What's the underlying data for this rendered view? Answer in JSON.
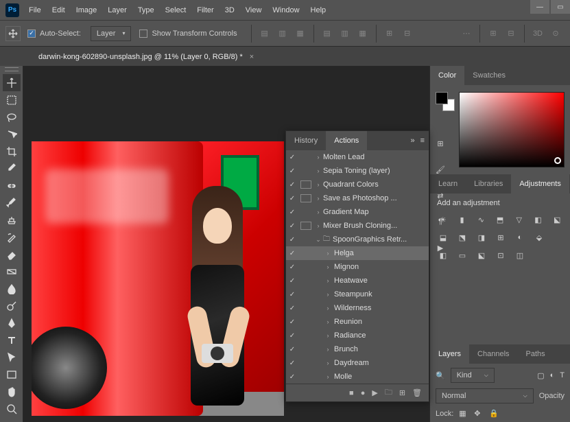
{
  "menu": {
    "items": [
      "File",
      "Edit",
      "Image",
      "Layer",
      "Type",
      "Select",
      "Filter",
      "3D",
      "View",
      "Window",
      "Help"
    ]
  },
  "logo": "Ps",
  "options": {
    "auto_select": "Auto-Select:",
    "layer_dd": "Layer",
    "show_transform": "Show Transform Controls",
    "threeD": "3D"
  },
  "document": {
    "title": "darwin-kong-602890-unsplash.jpg @ 11% (Layer 0, RGB/8) *"
  },
  "actions_panel": {
    "tabs": {
      "history": "History",
      "actions": "Actions"
    },
    "items": [
      {
        "label": "Molten Lead",
        "sq": false
      },
      {
        "label": "Sepia Toning (layer)",
        "sq": false
      },
      {
        "label": "Quadrant Colors",
        "sq": true
      },
      {
        "label": "Save as Photoshop ...",
        "sq": true
      },
      {
        "label": "Gradient Map",
        "sq": false
      },
      {
        "label": "Mixer Brush Cloning...",
        "sq": true
      }
    ],
    "folder": "SpoonGraphics Retr...",
    "children": [
      "Helga",
      "Mignon",
      "Heatwave",
      "Steampunk",
      "Wilderness",
      "Reunion",
      "Radiance",
      "Brunch",
      "Daydream",
      "Molle"
    ],
    "selected": "Helga"
  },
  "right": {
    "color_tabs": {
      "color": "Color",
      "swatches": "Swatches"
    },
    "adj_tabs": {
      "learn": "Learn",
      "libraries": "Libraries",
      "adjustments": "Adjustments"
    },
    "adj_title": "Add an adjustment",
    "layers_tabs": {
      "layers": "Layers",
      "channels": "Channels",
      "paths": "Paths"
    },
    "kind_icon": "🔍",
    "kind": "Kind",
    "blend": "Normal",
    "opacity": "Opacity",
    "lock": "Lock:"
  }
}
